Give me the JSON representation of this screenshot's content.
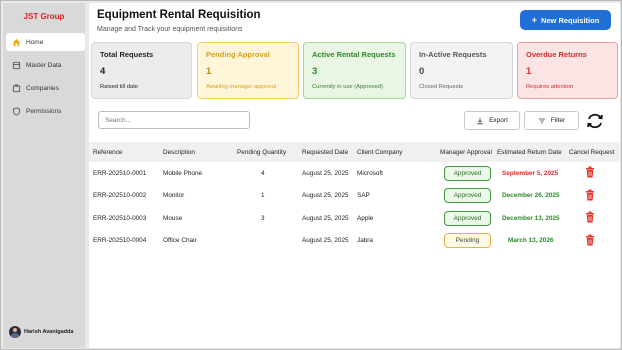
{
  "sidebar": {
    "brand": "JST Group",
    "items": [
      {
        "label": "Home",
        "icon": "home-icon"
      },
      {
        "label": "Master Data",
        "icon": "database-icon"
      },
      {
        "label": "Companies",
        "icon": "building-icon"
      },
      {
        "label": "Permissions",
        "icon": "shield-icon"
      }
    ],
    "user": {
      "name": "Harish Avanigadda"
    }
  },
  "header": {
    "title": "Equipment Rental Requisition",
    "subtitle": "Manage and Track your equipment requisitions",
    "new_button": "New Requisition"
  },
  "cards": [
    {
      "label": "Total Requests",
      "value": "4",
      "sub": "Raised till date"
    },
    {
      "label": "Pending Approval",
      "value": "1",
      "sub": "Awaiting manager approval"
    },
    {
      "label": "Active Rental Requests",
      "value": "3",
      "sub": "Currently in use (Approved)"
    },
    {
      "label": "In-Active Requests",
      "value": "0",
      "sub": "Closed Requests"
    },
    {
      "label": "Overdue Returns",
      "value": "1",
      "sub": "Requires attention"
    }
  ],
  "toolbar": {
    "search_placeholder": "Search...",
    "export_label": "Export",
    "filter_label": "Filter"
  },
  "table": {
    "headers": {
      "reference": "Reference",
      "description": "Description",
      "pending_qty": "Pending Quantity",
      "requested_date": "Requested Date",
      "client": "Client Company",
      "approval": "Manager Approval",
      "return_date": "Estimated Return Date",
      "cancel": "Cancel Request"
    },
    "rows": [
      {
        "reference": "ERR-202510-0001",
        "description": "Mobile Phone",
        "pending_qty": "4",
        "requested_date": "August 25, 2025",
        "client": "Microsoft",
        "approval": "Approved",
        "return_date": "September 5, 2025",
        "return_status": "overdue"
      },
      {
        "reference": "ERR-202510-0002",
        "description": "Monitor",
        "pending_qty": "1",
        "requested_date": "August 25, 2025",
        "client": "SAP",
        "approval": "Approved",
        "return_date": "December 26, 2025",
        "return_status": "ok"
      },
      {
        "reference": "ERR-202510-0003",
        "description": "Mouse",
        "pending_qty": "3",
        "requested_date": "August 25, 2025",
        "client": "Apple",
        "approval": "Approved",
        "return_date": "December 13, 2025",
        "return_status": "ok"
      },
      {
        "reference": "ERR-202510-0004",
        "description": "Office Chair",
        "pending_qty": "",
        "requested_date": "August 25, 2025",
        "client": "Jabra",
        "approval": "Pending",
        "return_date": "March 13, 2026",
        "return_status": "ok"
      }
    ]
  },
  "colors": {
    "brand_red": "#e01f1f",
    "primary_blue": "#1f6fd6",
    "overdue_red": "#e0262a",
    "ok_green": "#2c8a2a",
    "trash_red": "#e2352a"
  }
}
